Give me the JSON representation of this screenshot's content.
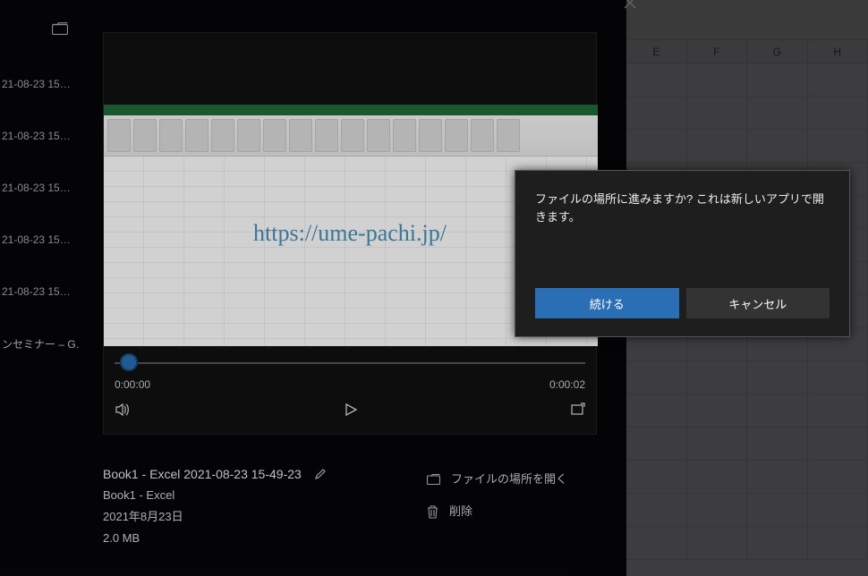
{
  "excel": {
    "columns": [
      "E",
      "F",
      "G",
      "H"
    ]
  },
  "leftList": {
    "items": [
      "21-08-23 15…",
      "21-08-23 15…",
      "21-08-23 15…",
      "21-08-23 15…",
      "21-08-23 15…",
      "ンセミナー – G…"
    ]
  },
  "video": {
    "watermark": "https://ume-pachi.jp/",
    "currentTime": "0:00:00",
    "duration": "0:00:02"
  },
  "meta": {
    "title": "Book1 - Excel 2021-08-23 15-49-23",
    "app": "Book1 - Excel",
    "date": "2021年8月23日",
    "size": "2.0 MB",
    "openLocation": "ファイルの場所を開く",
    "delete": "削除"
  },
  "dialog": {
    "message": "ファイルの場所に進みますか? これは新しいアプリで開きます。",
    "continue": "続ける",
    "cancel": "キャンセル"
  }
}
